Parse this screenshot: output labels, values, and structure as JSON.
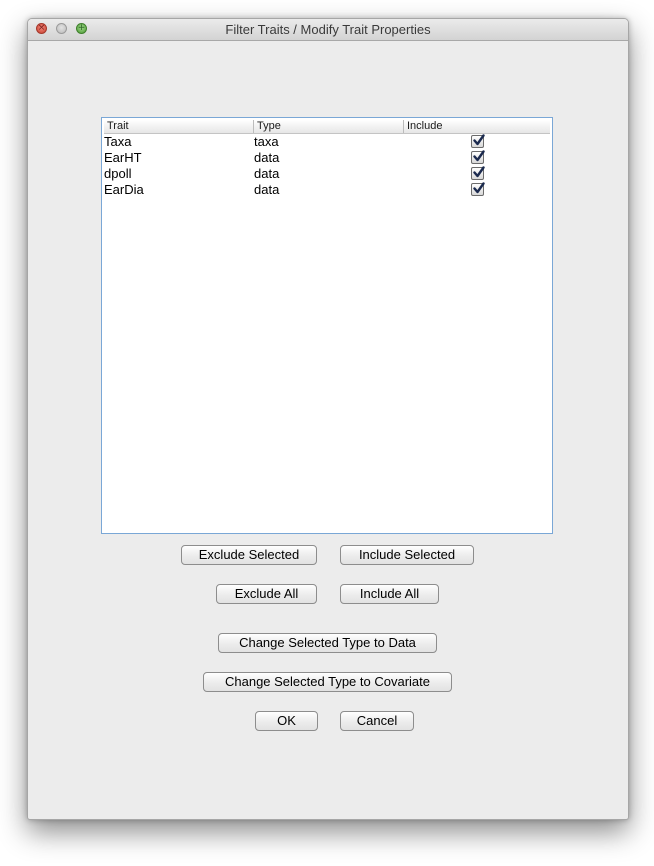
{
  "window": {
    "title": "Filter Traits / Modify Trait Properties",
    "close_glyph": "×",
    "min_glyph": "",
    "zoom_glyph": "+"
  },
  "table": {
    "columns": [
      "Trait",
      "Type",
      "Include"
    ],
    "rows": [
      {
        "trait": "Taxa",
        "type": "taxa",
        "include": true
      },
      {
        "trait": "EarHT",
        "type": "data",
        "include": true
      },
      {
        "trait": "dpoll",
        "type": "data",
        "include": true
      },
      {
        "trait": "EarDia",
        "type": "data",
        "include": true
      }
    ]
  },
  "buttons": {
    "exclude_selected": "Exclude Selected",
    "include_selected": "Include Selected",
    "exclude_all": "Exclude All",
    "include_all": "Include All",
    "change_to_data": "Change Selected Type to Data",
    "change_to_covariate": "Change Selected Type to Covariate",
    "ok": "OK",
    "cancel": "Cancel"
  },
  "colors": {
    "window_bg": "#ececec",
    "table_border": "#7aa7d6",
    "checkbox_tick": "#1b2a4e"
  }
}
